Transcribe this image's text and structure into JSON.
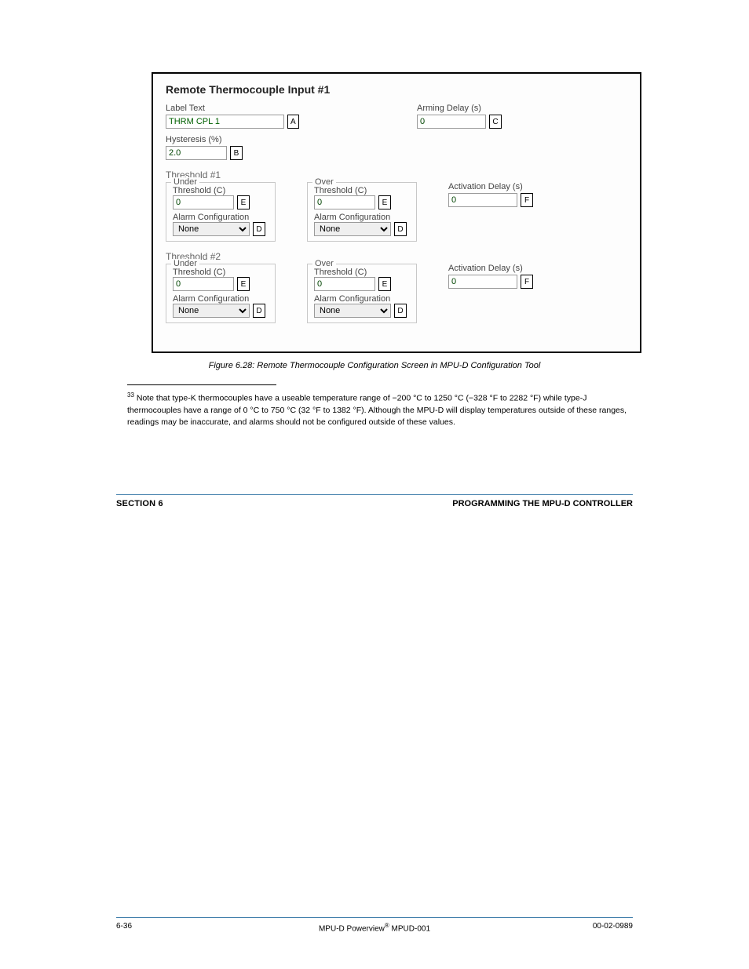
{
  "panel": {
    "title": "Remote Thermocouple Input #1",
    "labelText": {
      "label": "Label Text",
      "value": "THRM CPL 1",
      "letter": "A"
    },
    "armingDelay": {
      "label": "Arming Delay (s)",
      "value": "0",
      "letter": "C"
    },
    "hysteresis": {
      "label": "Hysteresis (%)",
      "value": "2.0",
      "letter": "B"
    },
    "thresholds": [
      {
        "title": "Threshold #1",
        "under": {
          "legend": "Under",
          "thresholdLabel": "Threshold (C)",
          "thresholdValue": "0",
          "thresholdLetter": "E",
          "alarmLabel": "Alarm Configuration",
          "alarmValue": "None",
          "alarmLetter": "D"
        },
        "over": {
          "legend": "Over",
          "thresholdLabel": "Threshold (C)",
          "thresholdValue": "0",
          "thresholdLetter": "E",
          "alarmLabel": "Alarm Configuration",
          "alarmValue": "None",
          "alarmLetter": "D"
        },
        "activation": {
          "label": "Activation Delay (s)",
          "value": "0",
          "letter": "F"
        }
      },
      {
        "title": "Threshold #2",
        "under": {
          "legend": "Under",
          "thresholdLabel": "Threshold (C)",
          "thresholdValue": "0",
          "thresholdLetter": "E",
          "alarmLabel": "Alarm Configuration",
          "alarmValue": "None",
          "alarmLetter": "D"
        },
        "over": {
          "legend": "Over",
          "thresholdLabel": "Threshold (C)",
          "thresholdValue": "0",
          "thresholdLetter": "E",
          "alarmLabel": "Alarm Configuration",
          "alarmValue": "None",
          "alarmLetter": "D"
        },
        "activation": {
          "label": "Activation Delay (s)",
          "value": "0",
          "letter": "F"
        }
      }
    ]
  },
  "caption": "Figure 6.28: Remote Thermocouple Configuration Screen in MPU-D Configuration Tool",
  "footnoteMarker": "33",
  "footnote": "Note that type-K thermocouples have a useable temperature range of −200 °C to 1250 °C (−328 °F to 2282 °F) while type-J thermocouples have a range of 0 °C to 750 °C (32 °F to 1382 °F). Although the MPU-D will display temperatures outside of these ranges, readings may be inaccurate, and alarms should not be configured outside of these values.",
  "section": {
    "left": "SECTION 6",
    "right": "PROGRAMMING THE MPU-D CONTROLLER"
  },
  "footer": {
    "left": "6-36",
    "centerPrefix": "MPU-D Powerview",
    "centerSuffix": " MPUD-001",
    "right": "00-02-0989"
  }
}
